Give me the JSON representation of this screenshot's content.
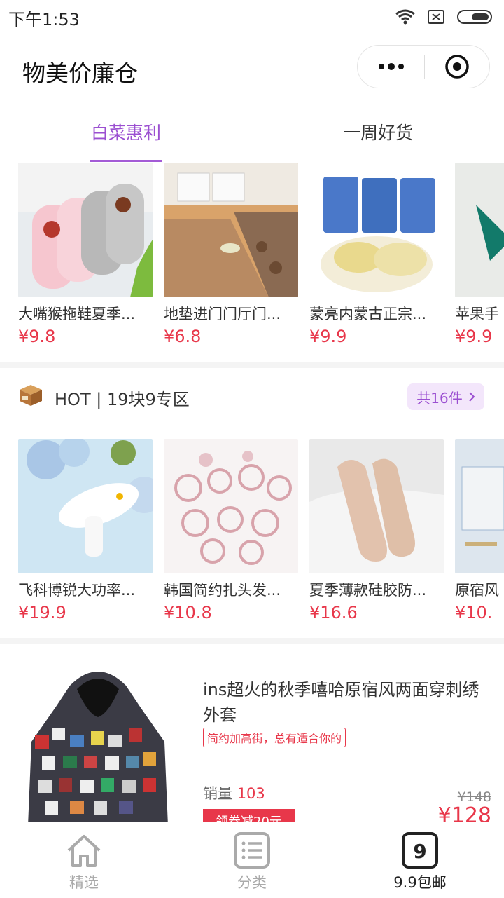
{
  "status": {
    "time": "下午1:53"
  },
  "header": {
    "title": "物美价廉仓"
  },
  "tabs": [
    {
      "label": "白菜惠利",
      "active": true
    },
    {
      "label": "一周好货",
      "active": false
    }
  ],
  "featured": [
    {
      "name": "大嘴猴拖鞋夏季...",
      "price": "¥9.8"
    },
    {
      "name": "地垫进门门厅门...",
      "price": "¥6.8"
    },
    {
      "name": "蒙亮内蒙古正宗...",
      "price": "¥9.9"
    },
    {
      "name": "苹果手",
      "price": "¥9.9"
    }
  ],
  "hot": {
    "label": "HOT | 19块9专区",
    "count": "共16件"
  },
  "hot_items": [
    {
      "name": "飞科博锐大功率...",
      "price": "¥19.9"
    },
    {
      "name": "韩国简约扎头发...",
      "price": "¥10.8"
    },
    {
      "name": "夏季薄款硅胶防...",
      "price": "¥16.6"
    },
    {
      "name": "原宿风",
      "price": "¥10."
    }
  ],
  "product": {
    "title": "ins超火的秋季嘻哈原宿风两面穿刺绣外套",
    "tag": "简约加高街，总有适合你的",
    "sales_label": "销量",
    "sales_value": "103",
    "original_price": "¥148",
    "coupon": "领券减20元",
    "price": "¥128"
  },
  "tabbar": [
    {
      "label": "精选",
      "icon": "home-icon",
      "active": false
    },
    {
      "label": "分类",
      "icon": "list-icon",
      "active": false
    },
    {
      "label": "9.9包邮",
      "icon": "nine-icon",
      "active": true
    }
  ],
  "colors": {
    "accent": "#9b4fd1",
    "price": "#e8374a"
  }
}
